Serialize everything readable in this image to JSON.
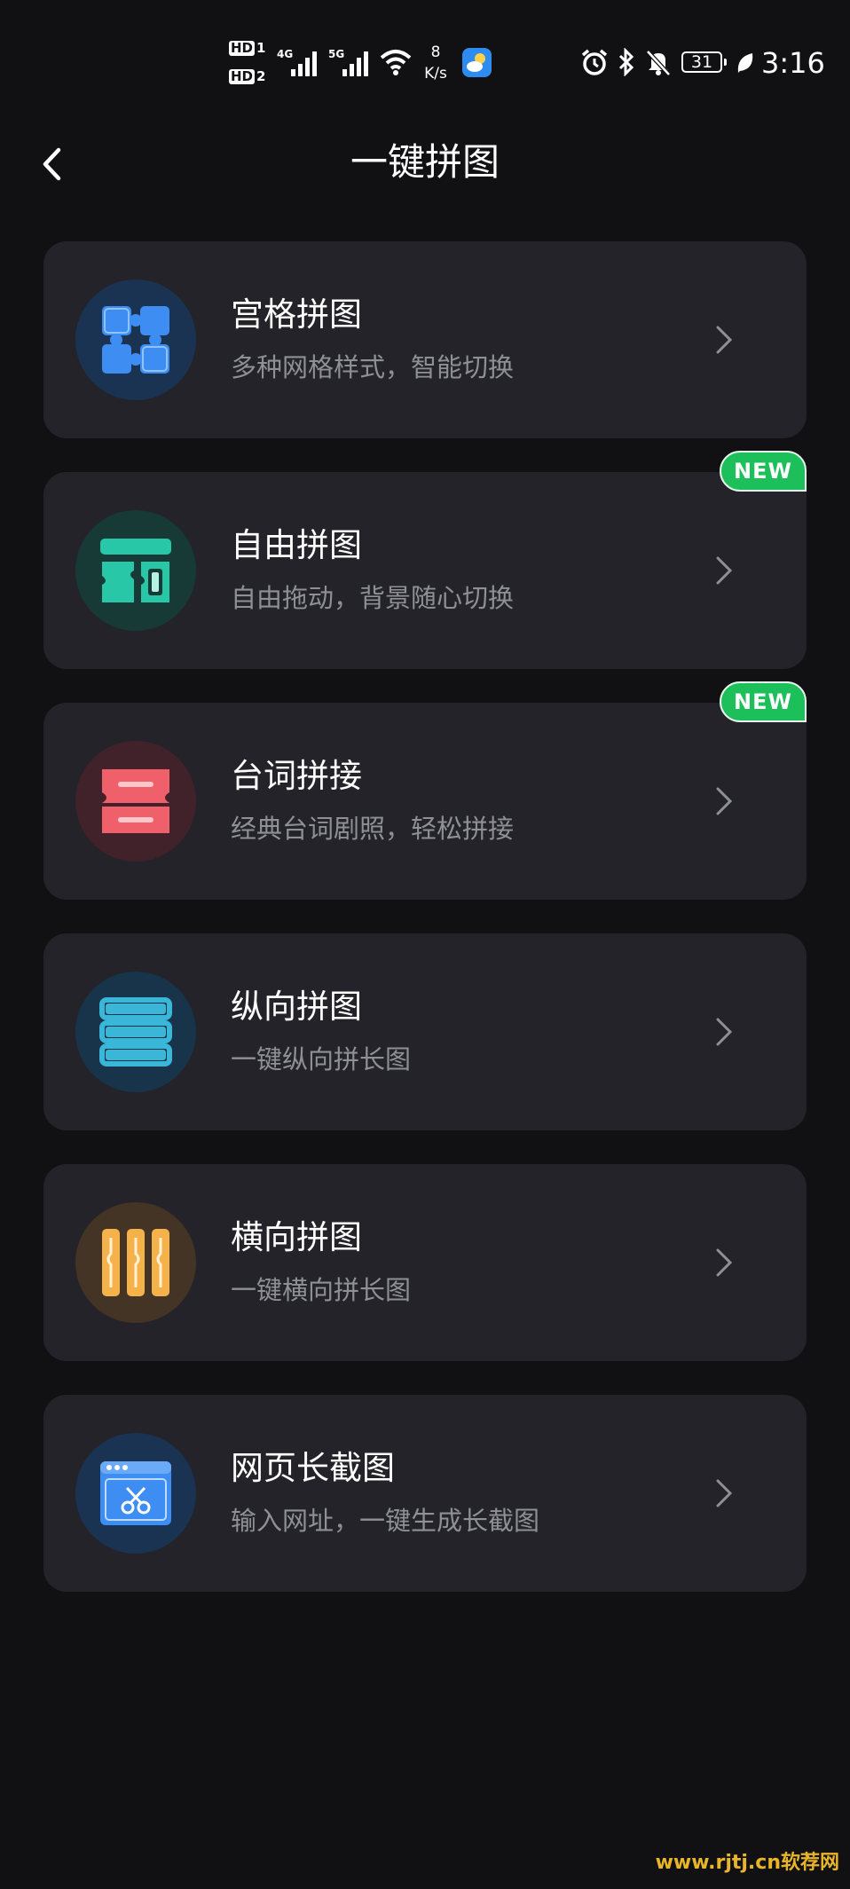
{
  "status_bar": {
    "hd1": "HD",
    "hd1_num": "1",
    "hd2": "HD",
    "hd2_num": "2",
    "net1": "4G",
    "net2": "5G",
    "speed_value": "8",
    "speed_unit": "K/s",
    "battery": "31",
    "time": "3:16"
  },
  "header": {
    "title": "一键拼图"
  },
  "items": [
    {
      "title": "宫格拼图",
      "subtitle": "多种网格样式，智能切换",
      "badge": "",
      "icon": "puzzle-grid-icon"
    },
    {
      "title": "自由拼图",
      "subtitle": "自由拖动，背景随心切换",
      "badge": "NEW",
      "icon": "free-puzzle-icon"
    },
    {
      "title": "台词拼接",
      "subtitle": "经典台词剧照，轻松拼接",
      "badge": "NEW",
      "icon": "caption-stitch-icon"
    },
    {
      "title": "纵向拼图",
      "subtitle": "一键纵向拼长图",
      "badge": "",
      "icon": "vertical-stitch-icon"
    },
    {
      "title": "横向拼图",
      "subtitle": "一键横向拼长图",
      "badge": "",
      "icon": "horizontal-stitch-icon"
    },
    {
      "title": "网页长截图",
      "subtitle": "输入网址，一键生成长截图",
      "badge": "",
      "icon": "webpage-screenshot-icon"
    }
  ],
  "watermark": "www.rjtj.cn软荐网",
  "colors": {
    "background": "#111114",
    "card": "#232329",
    "badge_green": "#1dbf5a",
    "blue": "#3d8df2",
    "teal": "#27c7a8",
    "red": "#f0606a",
    "cyan": "#3ab6d8",
    "orange": "#f6b24a"
  }
}
